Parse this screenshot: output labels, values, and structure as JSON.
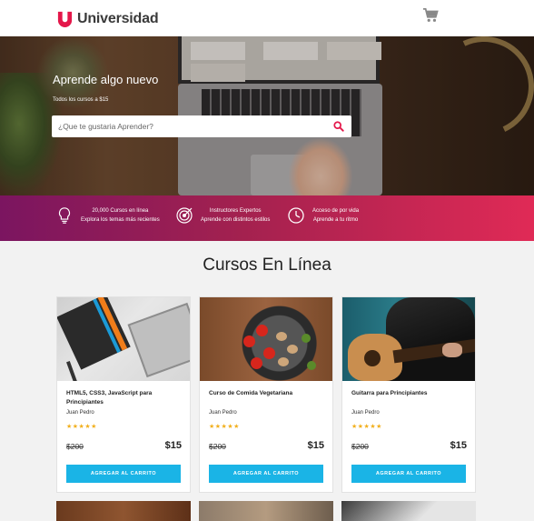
{
  "brand": {
    "name": "Universidad",
    "accent": "#e4174a"
  },
  "header": {
    "cart_icon": "cart-icon"
  },
  "hero": {
    "title": "Aprende algo nuevo",
    "subtitle": "Todos los cursos a $15",
    "search_placeholder": "¿Que te gustaria Aprender?",
    "search_icon": "search-icon"
  },
  "features": [
    {
      "icon": "lightbulb-icon",
      "line1": "20,000 Cursos en línea",
      "line2": "Explora los temas más recientes"
    },
    {
      "icon": "target-icon",
      "line1": "Instructores Expertos",
      "line2": "Aprende con distintos estilos"
    },
    {
      "icon": "clock-icon",
      "line1": "Acceso de por vida",
      "line2": "Aprende a tu ritmo"
    }
  ],
  "section": {
    "title": "Cursos En Línea"
  },
  "courses": [
    {
      "title": "HTML5, CSS3, JavaScript para Principiantes",
      "author": "Juan Pedro",
      "stars": "★★★★★",
      "old_price": "$200",
      "price": "$15",
      "button": "AGREGAR AL CARRITO"
    },
    {
      "title": "Curso de Comida Vegetariana",
      "author": "Juan Pedro",
      "stars": "★★★★★",
      "old_price": "$200",
      "price": "$15",
      "button": "AGREGAR AL CARRITO"
    },
    {
      "title": "Guitarra para Principiantes",
      "author": "Juan Pedro",
      "stars": "★★★★★",
      "old_price": "$200",
      "price": "$15",
      "button": "AGREGAR AL CARRITO"
    }
  ],
  "colors": {
    "button": "#1ab4e6",
    "star": "#f2b01e",
    "ribbon_start": "#7b1560",
    "ribbon_end": "#e02a56"
  }
}
